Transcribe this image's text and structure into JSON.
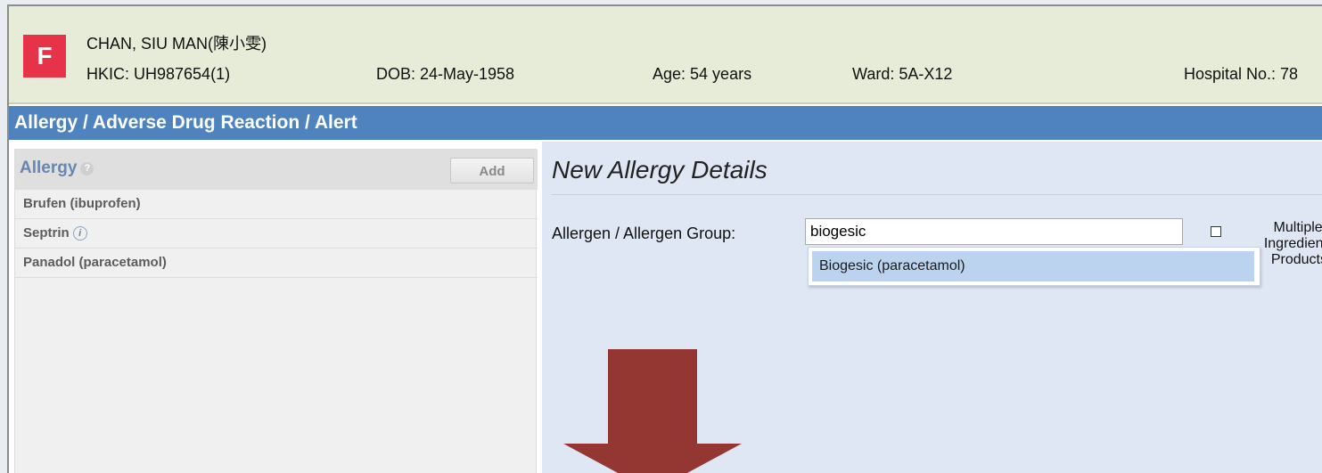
{
  "patient": {
    "sex": "F",
    "name": "CHAN, SIU MAN(陳小雯)",
    "hkic": "HKIC: UH987654(1)",
    "dob": "DOB: 24-May-1958",
    "age": "Age: 54 years",
    "ward": "Ward: 5A-X12",
    "hospital_no": "Hospital No.: 78"
  },
  "title_bar": "Allergy / Adverse Drug Reaction / Alert",
  "allergy_panel": {
    "title": "Allergy",
    "add_label": "Add",
    "items": [
      {
        "label": "Brufen (ibuprofen)",
        "info": false
      },
      {
        "label": "Septrin",
        "info": true
      },
      {
        "label": "Panadol (paracetamol)",
        "info": false
      }
    ]
  },
  "details": {
    "title": "New Allergy Details",
    "allergen_label": "Allergen / Allergen Group:",
    "allergen_value": "biogesic",
    "multi_ingredient_label": "Multiple-Ingredient Products",
    "suggestion": "Biogesic (paracetamol)"
  },
  "colors": {
    "sex_badge": "#e6334a",
    "title_bar": "#4e83be",
    "banner": "#e6ecd8",
    "arrow": "#943632",
    "suggestion_highlight": "#bcd3f0"
  },
  "icons": {
    "help": "help-icon",
    "info": "info-icon",
    "arrow": "down-arrow-icon"
  }
}
